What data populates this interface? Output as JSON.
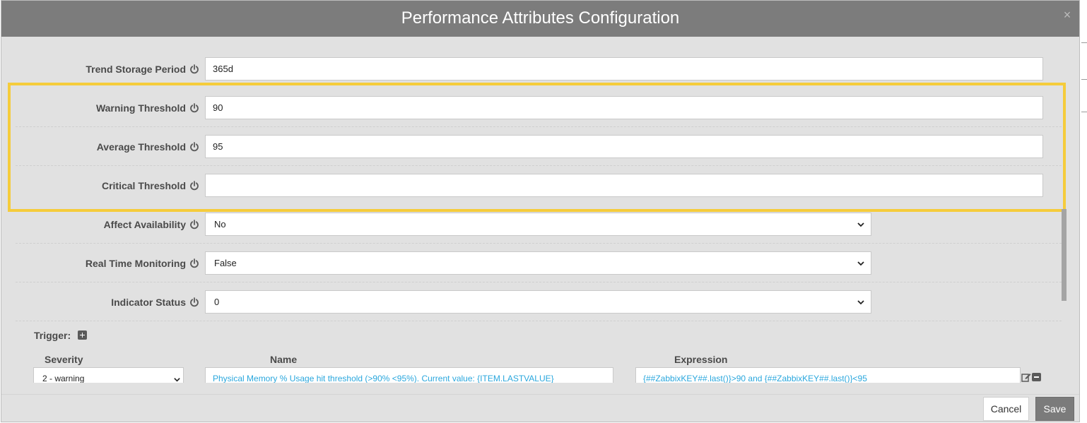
{
  "dialog": {
    "title": "Performance Attributes Configuration",
    "close_label": "×"
  },
  "fields": {
    "trend_storage_period": {
      "label": "Trend Storage Period",
      "value": "365d"
    },
    "warning_threshold": {
      "label": "Warning Threshold",
      "value": "90"
    },
    "average_threshold": {
      "label": "Average Threshold",
      "value": "95"
    },
    "critical_threshold": {
      "label": "Critical Threshold",
      "value": ""
    },
    "affect_availability": {
      "label": "Affect Availability",
      "value": "No"
    },
    "real_time_monitoring": {
      "label": "Real Time Monitoring",
      "value": "False"
    },
    "indicator_status": {
      "label": "Indicator Status",
      "value": "0"
    }
  },
  "trigger": {
    "label": "Trigger:",
    "columns": {
      "severity": "Severity",
      "name": "Name",
      "expression": "Expression"
    },
    "rows": [
      {
        "severity": "2 - warning",
        "name": "Physical Memory % Usage hit threshold (>90% <95%). Current value: {ITEM.LASTVALUE}",
        "expression": "{##ZabbixKEY##.last()}>90 and {##ZabbixKEY##.last()}<95"
      }
    ]
  },
  "footer": {
    "cancel_label": "Cancel",
    "save_label": "Save"
  },
  "colors": {
    "header_bg": "#7c7c7c",
    "body_bg": "#e1e1e1",
    "highlight_border": "#f5cc3b",
    "trigger_text": "#2aa7dd",
    "save_bg": "#7b7b7b"
  },
  "icons": {
    "field_info": "power-icon",
    "trigger_add": "plus-icon",
    "trigger_edit": "edit-icon",
    "trigger_remove": "minus-icon",
    "select": "chevron-down-icon"
  }
}
